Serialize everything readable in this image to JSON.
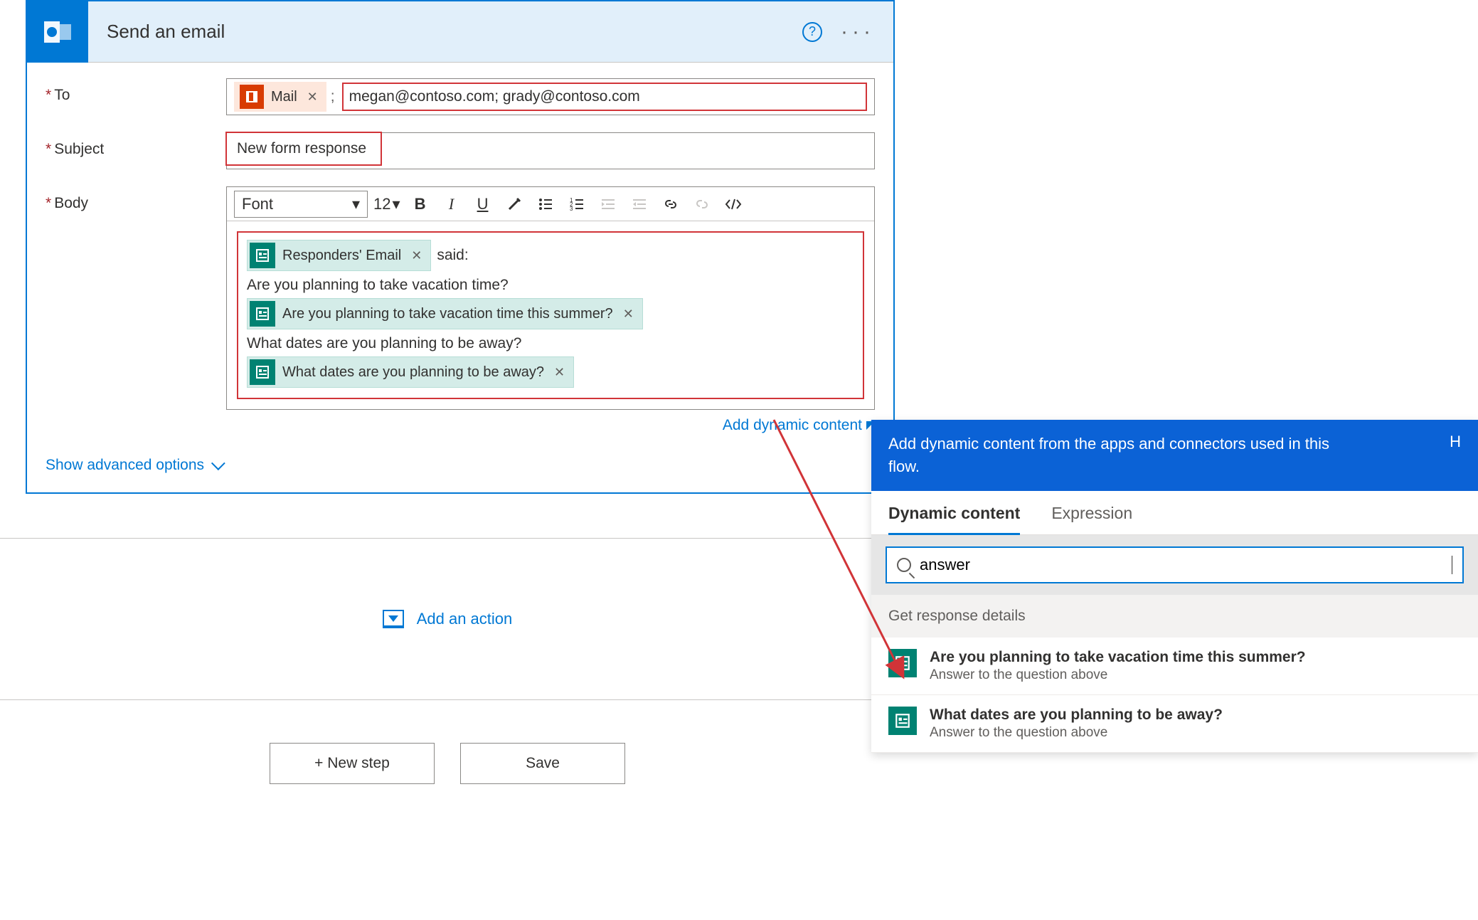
{
  "card": {
    "title": "Send an email",
    "fields": {
      "to_label": "To",
      "subject_label": "Subject",
      "body_label": "Body"
    },
    "to": {
      "token_label": "Mail",
      "value": "megan@contoso.com; grady@contoso.com"
    },
    "subject": {
      "value": "New form response"
    },
    "toolbar": {
      "font_label": "Font",
      "font_size": "12"
    },
    "body": {
      "token_responders": "Responders' Email",
      "said_label": "said:",
      "q1_text": "Are you planning to take vacation time?",
      "q1_token": "Are you planning to take vacation time this summer?",
      "q2_text": "What dates are you planning to be away?",
      "q2_token": "What dates are you planning to be away?"
    },
    "add_dynamic": "Add dynamic content",
    "show_advanced": "Show advanced options",
    "add_action": "Add an action"
  },
  "buttons": {
    "new_step": "+ New step",
    "save": "Save"
  },
  "dc_panel": {
    "banner": "Add dynamic content from the apps and connectors used in this flow.",
    "banner_right": "H",
    "tab_dynamic": "Dynamic content",
    "tab_expression": "Expression",
    "search_value": "answer",
    "section_title": "Get response details",
    "items": [
      {
        "title": "Are you planning to take vacation time this summer?",
        "sub": "Answer to the question above"
      },
      {
        "title": "What dates are you planning to be away?",
        "sub": "Answer to the question above"
      }
    ]
  }
}
